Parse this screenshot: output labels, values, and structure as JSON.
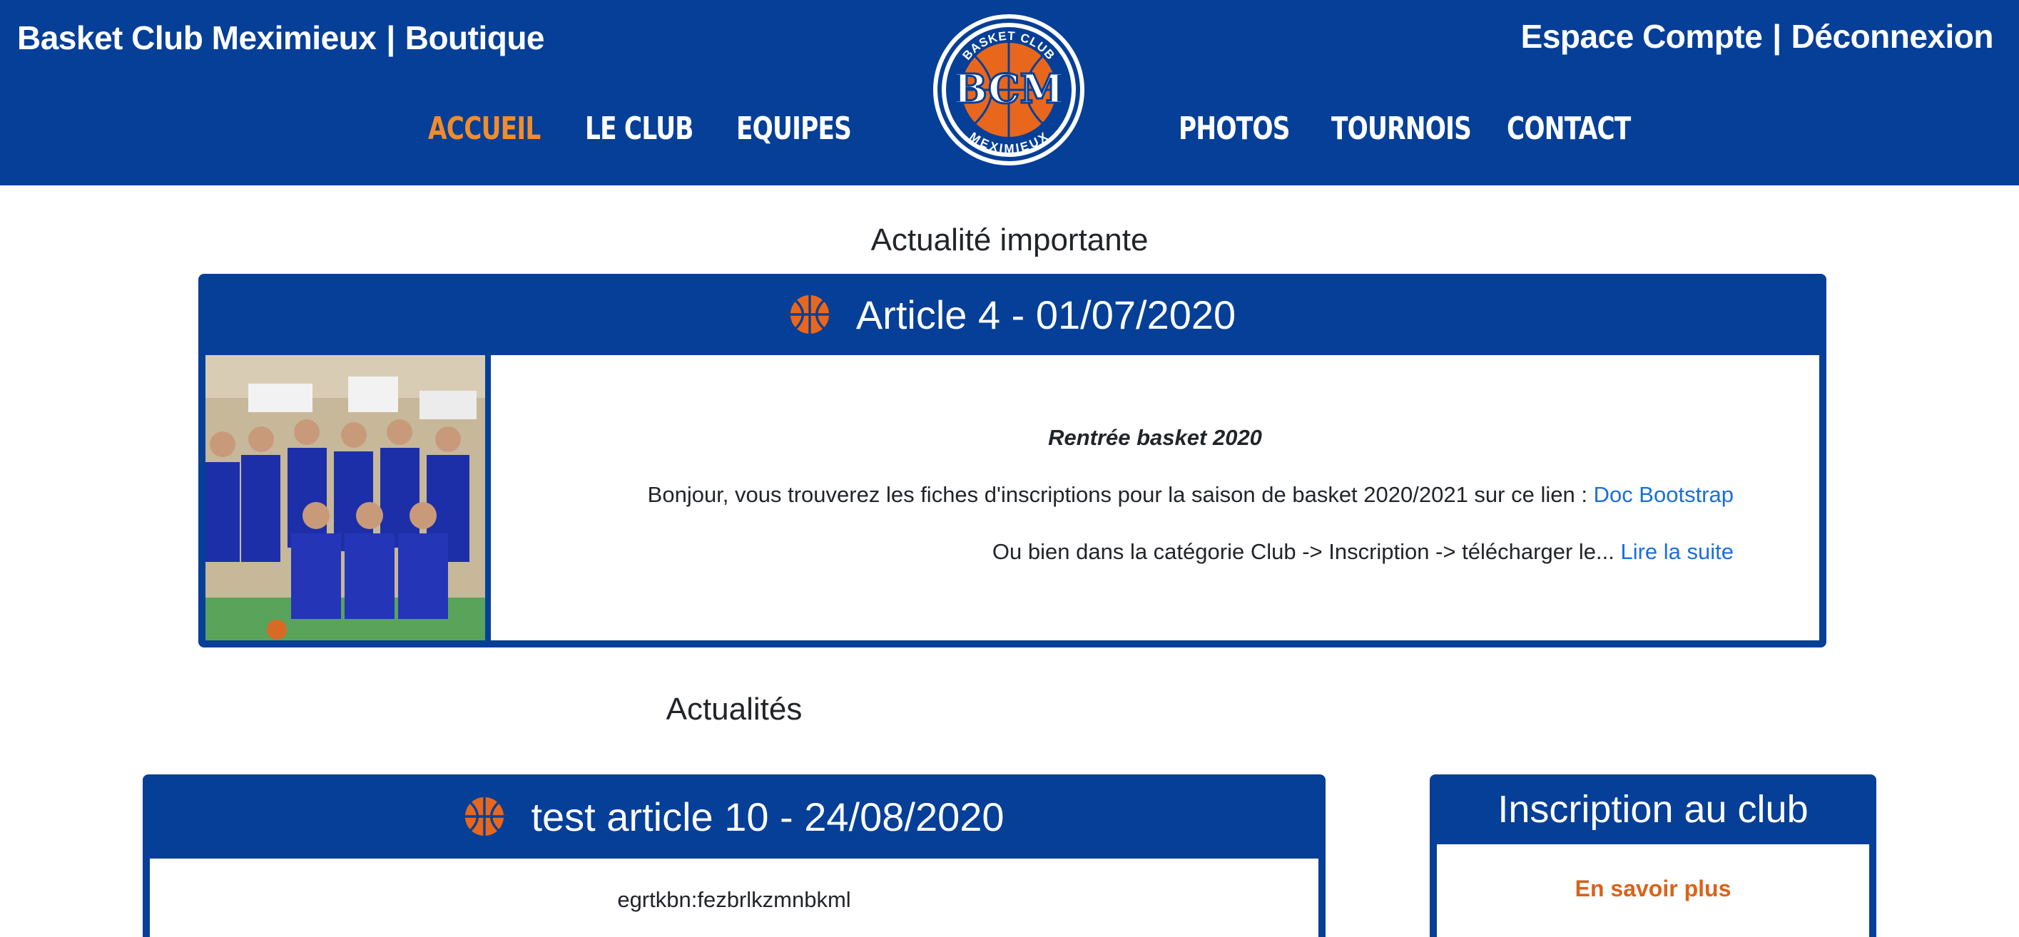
{
  "header": {
    "brand": "Basket Club Meximieux",
    "separator": "|",
    "shop": "Boutique",
    "account": "Espace Compte",
    "logout": "Déconnexion",
    "logo": {
      "top_text": "BASKET CLUB",
      "initials": "BCM",
      "bottom_text": "MEXIMIEUX"
    }
  },
  "nav": {
    "home": "ACCUEIL",
    "club": "LE CLUB",
    "teams": "EQUIPES",
    "photos": "PHOTOS",
    "tournaments": "TOURNOIS",
    "contact": "CONTACT"
  },
  "featured": {
    "section_title": "Actualité importante",
    "title": "Article 4 - 01/07/2020",
    "heading": "Rentrée basket 2020",
    "para1": "Bonjour, vous trouverez les fiches d'inscriptions pour la saison de basket 2020/2021 sur ce lien : ",
    "para1_link": "Doc Bootstrap",
    "para2": "Ou bien dans la catégorie Club -> Inscription -> télécharger le... ",
    "para2_link": "Lire la suite"
  },
  "news": {
    "section_title": "Actualités",
    "title": "test article 10 - 24/08/2020",
    "body": "egrtkbn:fezbrlkzmnbkml"
  },
  "sidebar": {
    "title": "Inscription au club",
    "link": "En savoir plus"
  },
  "colors": {
    "primary": "#063f97",
    "accent_orange": "#f28c2a",
    "link_blue": "#1a6fd9",
    "sidebar_link": "#d9631a"
  }
}
